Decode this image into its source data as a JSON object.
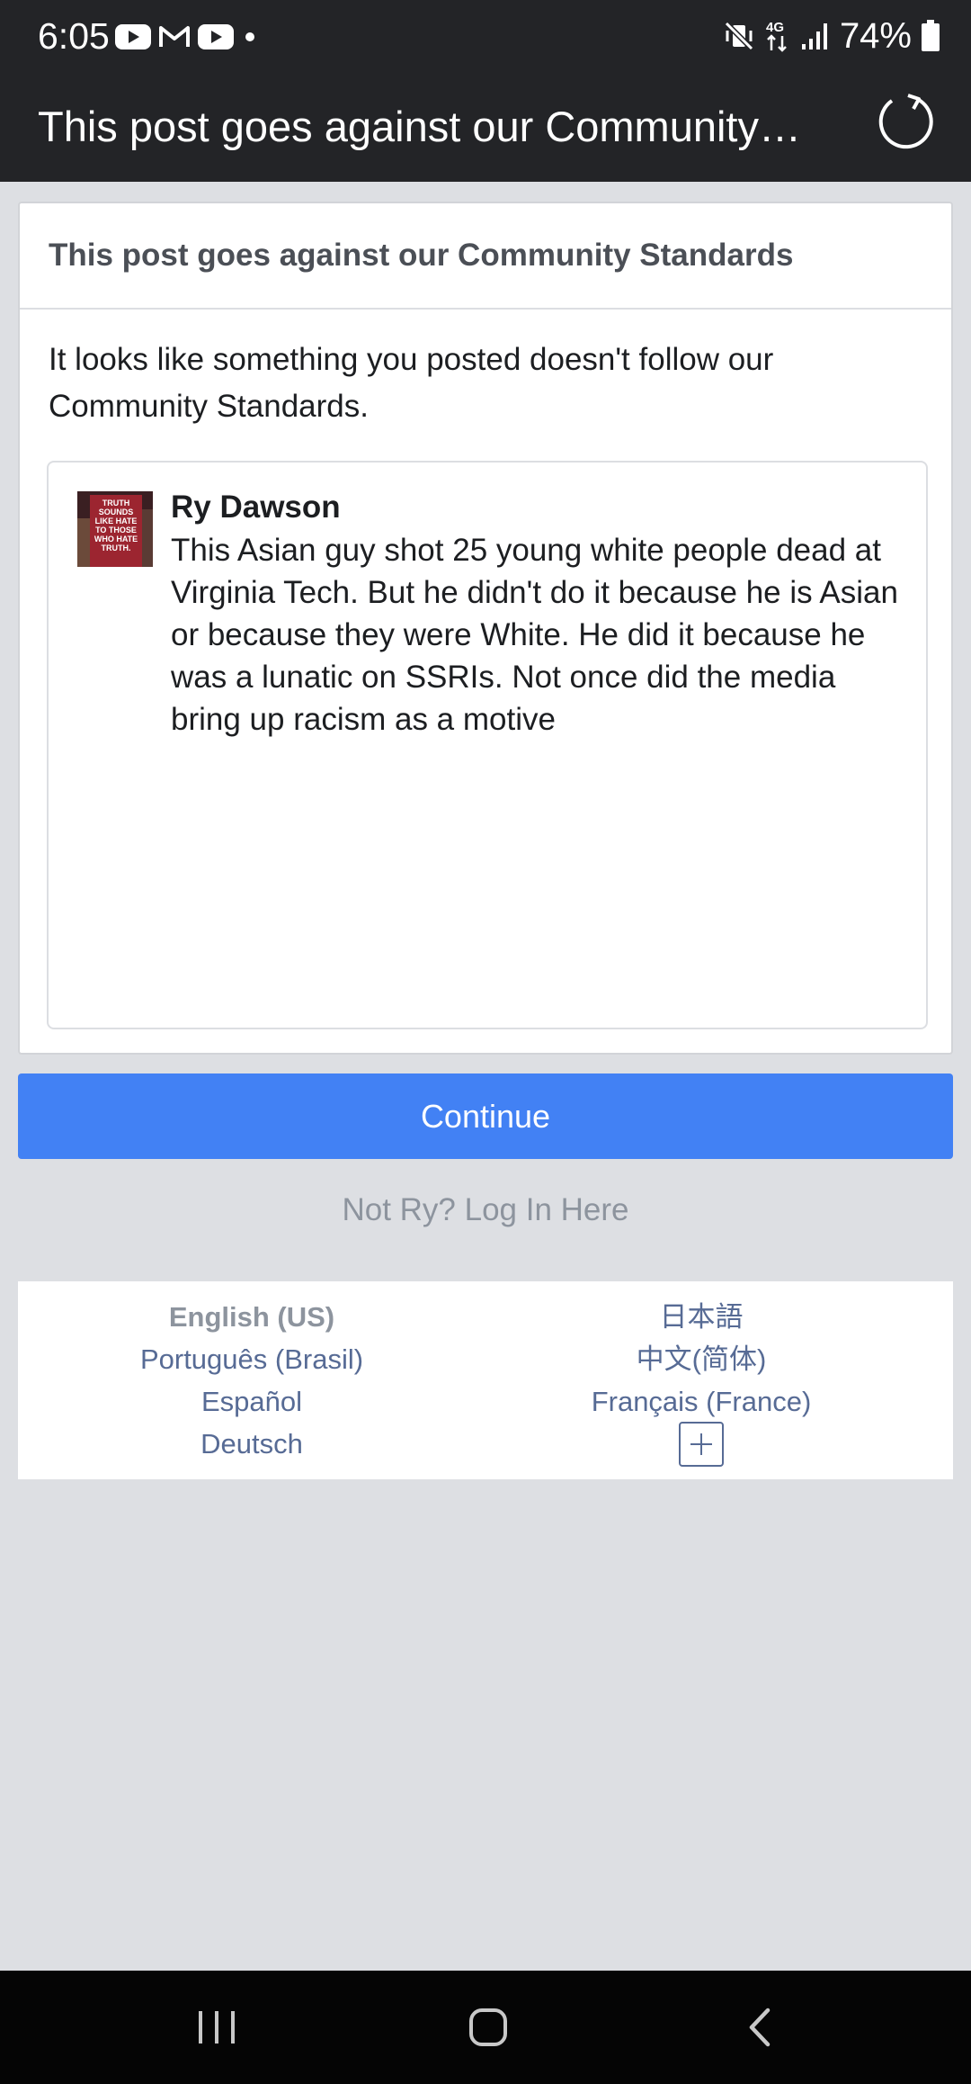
{
  "status_bar": {
    "time": "6:05",
    "notification_icons": [
      "youtube-icon",
      "gmail-icon",
      "youtube-icon",
      "dot-icon"
    ],
    "network": "4G",
    "battery_percent": "74%"
  },
  "toolbar": {
    "title": "This post goes against our Community…"
  },
  "card": {
    "header": "This post goes against our Community Standards",
    "message": "It looks like something you posted doesn't follow our Community Standards.",
    "post": {
      "avatar_sign_text": "TRUTH SOUNDS LIKE HATE TO THOSE WHO HATE TRUTH.",
      "author": "Ry Dawson",
      "text": "This Asian guy shot 25 young white people dead at Virginia Tech. But he didn't do it because he is Asian or because they were White. He did it because he was a lunatic on SSRIs. Not once did the media bring up racism as a motive"
    }
  },
  "continue_label": "Continue",
  "not_user_link": "Not Ry? Log In Here",
  "languages": {
    "left": [
      "English (US)",
      "Português (Brasil)",
      "Español",
      "Deutsch"
    ],
    "right": [
      "日本語",
      "中文(简体)",
      "Français (France)"
    ]
  },
  "colors": {
    "accent": "#4281f4",
    "dark_bar": "#232427",
    "background": "#dddfe3",
    "link": "#576b95"
  }
}
